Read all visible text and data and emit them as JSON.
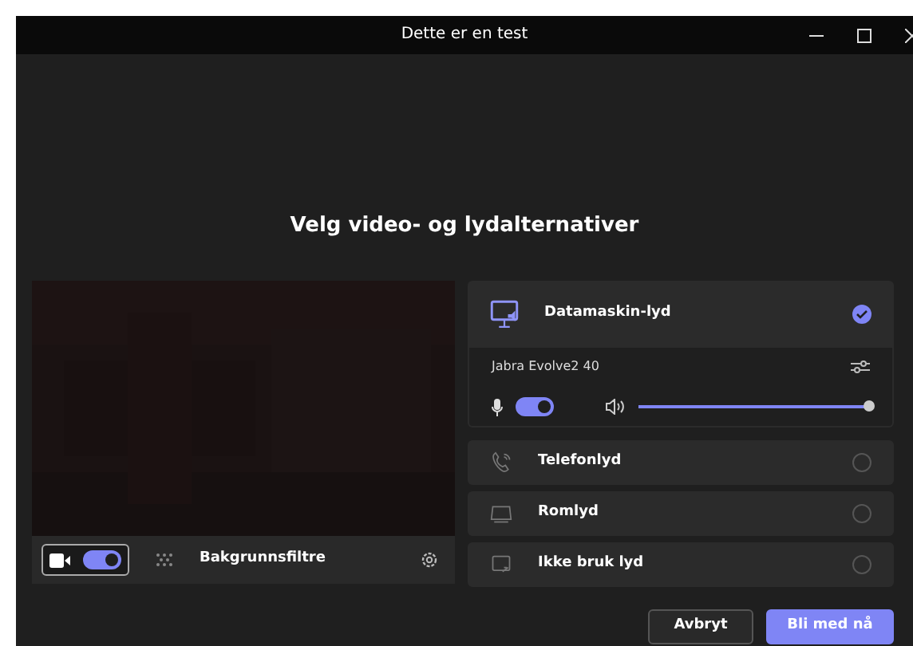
{
  "window": {
    "title": "Dette er en test"
  },
  "heading": "Velg video- og lydalternativer",
  "video": {
    "camera_on": true,
    "background_filters": "Bakgrunnsfiltre"
  },
  "audio_options": [
    {
      "kind": "computer",
      "label": "Datamaskin-lyd",
      "selected": true,
      "device": "Jabra Evolve2 40",
      "mic_on": true,
      "speaker": {
        "level": 1
      }
    },
    {
      "kind": "phone",
      "label": "Telefonlyd",
      "selected": false
    },
    {
      "kind": "room",
      "label": "Romlyd",
      "selected": false
    },
    {
      "kind": "none",
      "label": "Ikke bruk lyd",
      "selected": false
    }
  ],
  "buttons": [
    {
      "label": "Avbryt",
      "kind": "secondary"
    },
    {
      "label": "Bli med nå",
      "kind": "primary"
    }
  ]
}
